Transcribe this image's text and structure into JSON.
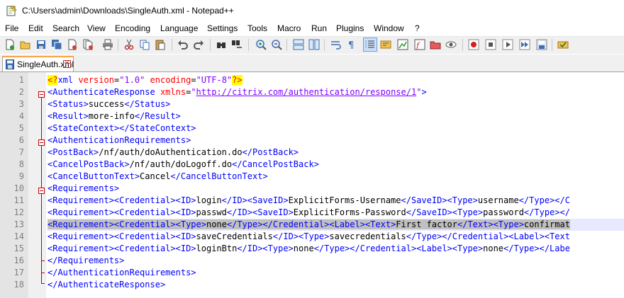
{
  "window": {
    "title": "C:\\Users\\admin\\Downloads\\SingleAuth.xml - Notepad++",
    "app_icon": "notepadpp-icon"
  },
  "menu": [
    "File",
    "Edit",
    "Search",
    "View",
    "Encoding",
    "Language",
    "Settings",
    "Tools",
    "Macro",
    "Run",
    "Plugins",
    "Window",
    "?"
  ],
  "toolbar": {
    "icons": [
      "new-file-icon",
      "open-file-icon",
      "save-icon",
      "save-all-icon",
      "close-icon",
      "close-all-icon",
      "print-icon",
      "cut-icon",
      "copy-icon",
      "paste-icon",
      "undo-icon",
      "redo-icon",
      "find-icon",
      "replace-icon",
      "zoom-in-icon",
      "zoom-out-icon",
      "sync-vertical-icon",
      "sync-horizontal-icon",
      "word-wrap-icon",
      "show-all-chars-icon",
      "indent-guide-icon",
      "user-lang-icon",
      "doc-map-icon",
      "function-list-icon",
      "folder-workspace-icon",
      "monitoring-icon",
      "record-macro-icon",
      "stop-macro-icon",
      "play-macro-icon",
      "run-macro-multiple-icon",
      "save-macro-icon",
      "spell-check-icon"
    ]
  },
  "tabs": [
    {
      "label": "SingleAuth.xml",
      "icon": "file-saved-icon",
      "close": "✕"
    }
  ],
  "editor": {
    "line_numbers": [
      "1",
      "2",
      "3",
      "4",
      "5",
      "6",
      "7",
      "8",
      "9",
      "10",
      "11",
      "12",
      "13",
      "14",
      "15",
      "16",
      "17",
      "18"
    ],
    "lines": [
      "<?xml version=\"1.0\" encoding=\"UTF-8\"?>",
      "<AuthenticateResponse xmlns=\"http://citrix.com/authentication/response/1\">",
      "<Status>success</Status>",
      "<Result>more-info</Result>",
      "<StateContext></StateContext>",
      "<AuthenticationRequirements>",
      "<PostBack>/nf/auth/doAuthentication.do</PostBack>",
      "<CancelPostBack>/nf/auth/doLogoff.do</CancelPostBack>",
      "<CancelButtonText>Cancel</CancelButtonText>",
      "<Requirements>",
      "<Requirement><Credential><ID>login</ID><SaveID>ExplicitForms-Username</SaveID><Type>username</Type></C",
      "<Requirement><Credential><ID>passwd</ID><SaveID>ExplicitForms-Password</SaveID><Type>password</Type></",
      "<Requirement><Credential><Type>none</Type></Credential><Label><Text>First factor</Text><Type>confirmat",
      "<Requirement><Credential><ID>saveCredentials</ID><Type>savecredentials</Type></Credential><Label><Text",
      "<Requirement><Credential><ID>loginBtn</ID><Type>none</Type></Credential><Label><Type>none</Type></Labe",
      "</Requirements>",
      "</AuthenticationRequirements>",
      "</AuthenticateResponse>"
    ],
    "selected_line": 13
  },
  "colors": {
    "tag": "#0000ff",
    "attribute": "#ff0000",
    "value": "#8000ff",
    "text": "#000000",
    "fold_marker": "#c00000",
    "tab_accent": "#f8a443"
  }
}
